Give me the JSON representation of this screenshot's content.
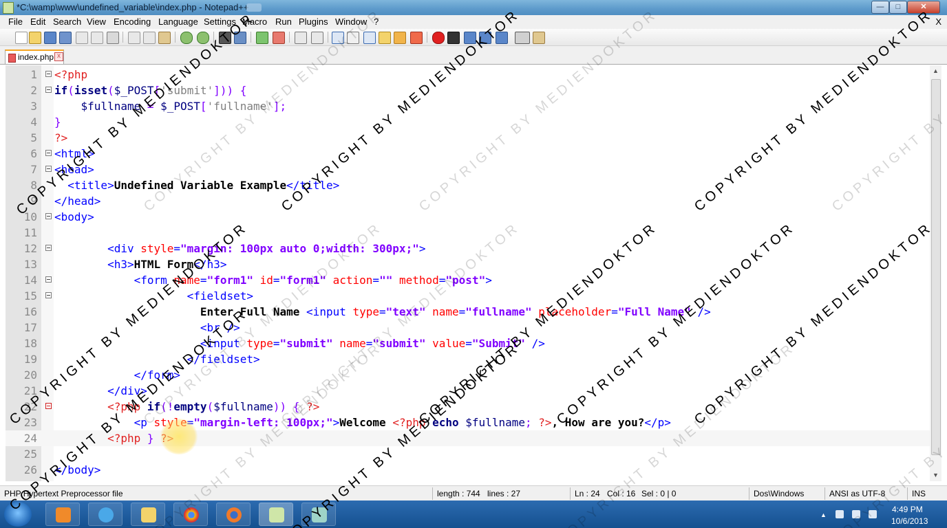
{
  "window": {
    "title": "*C:\\wamp\\www\\undefined_variable\\index.php - Notepad++"
  },
  "menu": [
    "File",
    "Edit",
    "Search",
    "View",
    "Encoding",
    "Language",
    "Settings",
    "Macro",
    "Run",
    "Plugins",
    "Window",
    "?"
  ],
  "menu_close": "X",
  "tab": {
    "name": "index.php",
    "close": "x"
  },
  "lines": [
    {
      "n": "1",
      "tokens": [
        {
          "t": "<?php",
          "c": "php"
        }
      ]
    },
    {
      "n": "2",
      "tokens": [
        {
          "t": "if",
          "c": "kw"
        },
        {
          "t": "(",
          "c": "op"
        },
        {
          "t": "isset",
          "c": "fn"
        },
        {
          "t": "(",
          "c": "op"
        },
        {
          "t": "$_POST",
          "c": "var"
        },
        {
          "t": "[",
          "c": "op"
        },
        {
          "t": "'submit'",
          "c": "str"
        },
        {
          "t": "])) {",
          "c": "op"
        }
      ]
    },
    {
      "n": "3",
      "tokens": [
        {
          "t": "    $fullname ",
          "c": "var"
        },
        {
          "t": "= ",
          "c": "op"
        },
        {
          "t": "$_POST",
          "c": "var"
        },
        {
          "t": "[",
          "c": "op"
        },
        {
          "t": "'fullname'",
          "c": "str"
        },
        {
          "t": "];",
          "c": "op"
        }
      ]
    },
    {
      "n": "4",
      "tokens": [
        {
          "t": "}",
          "c": "op"
        }
      ]
    },
    {
      "n": "5",
      "tokens": [
        {
          "t": "?>",
          "c": "php"
        }
      ]
    },
    {
      "n": "6",
      "tokens": [
        {
          "t": "<html>",
          "c": "tag"
        }
      ]
    },
    {
      "n": "7",
      "tokens": [
        {
          "t": "<head>",
          "c": "tag"
        }
      ]
    },
    {
      "n": "8",
      "tokens": [
        {
          "t": "  <title>",
          "c": "tag"
        },
        {
          "t": "Undefined Variable Example",
          "c": "txt"
        },
        {
          "t": "</title>",
          "c": "tag"
        }
      ]
    },
    {
      "n": "9",
      "tokens": [
        {
          "t": "</head>",
          "c": "tag"
        }
      ]
    },
    {
      "n": "10",
      "tokens": [
        {
          "t": "<body>",
          "c": "tag"
        }
      ]
    },
    {
      "n": "11",
      "tokens": []
    },
    {
      "n": "12",
      "tokens": [
        {
          "t": "        <div ",
          "c": "tag"
        },
        {
          "t": "style",
          "c": "attr"
        },
        {
          "t": "=",
          "c": "tag"
        },
        {
          "t": "\"margin: 100px auto 0;width: 300px;\"",
          "c": "aval"
        },
        {
          "t": ">",
          "c": "tag"
        }
      ]
    },
    {
      "n": "13",
      "tokens": [
        {
          "t": "        <h3>",
          "c": "tag"
        },
        {
          "t": "HTML Form",
          "c": "txt"
        },
        {
          "t": "</h3>",
          "c": "tag"
        }
      ]
    },
    {
      "n": "14",
      "tokens": [
        {
          "t": "            <form ",
          "c": "tag"
        },
        {
          "t": "name",
          "c": "attr"
        },
        {
          "t": "=",
          "c": "tag"
        },
        {
          "t": "\"form1\"",
          "c": "aval"
        },
        {
          "t": " ",
          "c": "tag"
        },
        {
          "t": "id",
          "c": "attr"
        },
        {
          "t": "=",
          "c": "tag"
        },
        {
          "t": "\"form1\"",
          "c": "aval"
        },
        {
          "t": " ",
          "c": "tag"
        },
        {
          "t": "action",
          "c": "attr"
        },
        {
          "t": "=",
          "c": "tag"
        },
        {
          "t": "\"\"",
          "c": "aval"
        },
        {
          "t": " ",
          "c": "tag"
        },
        {
          "t": "method",
          "c": "attr"
        },
        {
          "t": "=",
          "c": "tag"
        },
        {
          "t": "\"post\"",
          "c": "aval"
        },
        {
          "t": ">",
          "c": "tag"
        }
      ]
    },
    {
      "n": "15",
      "tokens": [
        {
          "t": "                    <fieldset>",
          "c": "tag"
        }
      ]
    },
    {
      "n": "16",
      "tokens": [
        {
          "t": "                      ",
          "c": "def"
        },
        {
          "t": "Enter Full Name ",
          "c": "txt"
        },
        {
          "t": "<input ",
          "c": "tag"
        },
        {
          "t": "type",
          "c": "attr"
        },
        {
          "t": "=",
          "c": "tag"
        },
        {
          "t": "\"text\"",
          "c": "aval"
        },
        {
          "t": " ",
          "c": "tag"
        },
        {
          "t": "name",
          "c": "attr"
        },
        {
          "t": "=",
          "c": "tag"
        },
        {
          "t": "\"fullname\"",
          "c": "aval"
        },
        {
          "t": " ",
          "c": "tag"
        },
        {
          "t": "placeholder",
          "c": "attr"
        },
        {
          "t": "=",
          "c": "tag"
        },
        {
          "t": "\"Full Name\"",
          "c": "aval"
        },
        {
          "t": " />",
          "c": "tag"
        }
      ]
    },
    {
      "n": "17",
      "tokens": [
        {
          "t": "                      <br />",
          "c": "tag"
        }
      ]
    },
    {
      "n": "18",
      "tokens": [
        {
          "t": "                      <input ",
          "c": "tag"
        },
        {
          "t": "type",
          "c": "attr"
        },
        {
          "t": "=",
          "c": "tag"
        },
        {
          "t": "\"submit\"",
          "c": "aval"
        },
        {
          "t": " ",
          "c": "tag"
        },
        {
          "t": "name",
          "c": "attr"
        },
        {
          "t": "=",
          "c": "tag"
        },
        {
          "t": "\"submit\"",
          "c": "aval"
        },
        {
          "t": " ",
          "c": "tag"
        },
        {
          "t": "value",
          "c": "attr"
        },
        {
          "t": "=",
          "c": "tag"
        },
        {
          "t": "\"Submit\"",
          "c": "aval"
        },
        {
          "t": " />",
          "c": "tag"
        }
      ]
    },
    {
      "n": "19",
      "tokens": [
        {
          "t": "                    </fieldset>",
          "c": "tag"
        }
      ]
    },
    {
      "n": "20",
      "tokens": [
        {
          "t": "            </form>",
          "c": "tag"
        }
      ]
    },
    {
      "n": "21",
      "tokens": [
        {
          "t": "        </div>",
          "c": "tag"
        }
      ]
    },
    {
      "n": "22",
      "tokens": [
        {
          "t": "        <?php ",
          "c": "php"
        },
        {
          "t": "if",
          "c": "kw"
        },
        {
          "t": "(!",
          "c": "op"
        },
        {
          "t": "empty",
          "c": "fn"
        },
        {
          "t": "(",
          "c": "op"
        },
        {
          "t": "$fullname",
          "c": "var"
        },
        {
          "t": ")) {",
          "c": "op"
        },
        {
          "t": " ?>",
          "c": "php"
        }
      ]
    },
    {
      "n": "23",
      "tokens": [
        {
          "t": "            <p ",
          "c": "tag"
        },
        {
          "t": "style",
          "c": "attr"
        },
        {
          "t": "=",
          "c": "tag"
        },
        {
          "t": "\"margin-left: 100px;\"",
          "c": "aval"
        },
        {
          "t": ">",
          "c": "tag"
        },
        {
          "t": "Welcome ",
          "c": "txt"
        },
        {
          "t": "<?php ",
          "c": "php"
        },
        {
          "t": "echo ",
          "c": "kw"
        },
        {
          "t": "$fullname",
          "c": "var"
        },
        {
          "t": "; ",
          "c": "op"
        },
        {
          "t": "?>",
          "c": "php"
        },
        {
          "t": ", How are you?",
          "c": "txt"
        },
        {
          "t": "</p>",
          "c": "tag"
        }
      ]
    },
    {
      "n": "24",
      "tokens": [
        {
          "t": "        <?php ",
          "c": "php"
        },
        {
          "t": "} ",
          "c": "op"
        },
        {
          "t": "?>",
          "c": "php"
        }
      ]
    },
    {
      "n": "25",
      "tokens": []
    },
    {
      "n": "26",
      "tokens": [
        {
          "t": "</body>",
          "c": "tag"
        }
      ]
    }
  ],
  "status": {
    "filetype": "PHP Hypertext Preprocessor file",
    "length": "length : 744",
    "lines": "lines : 27",
    "ln": "Ln : 24",
    "col": "Col : 16",
    "sel": "Sel : 0 | 0",
    "eol": "Dos\\Windows",
    "encoding": "ANSI as UTF-8",
    "mode": "INS"
  },
  "clock": {
    "time": "4:49 PM",
    "date": "10/6/2013"
  },
  "watermark": "COPYRIGHT BY MEDIENDOKTOR",
  "colors": {
    "accent": "#f5a623",
    "taskbar": "#14508f"
  }
}
